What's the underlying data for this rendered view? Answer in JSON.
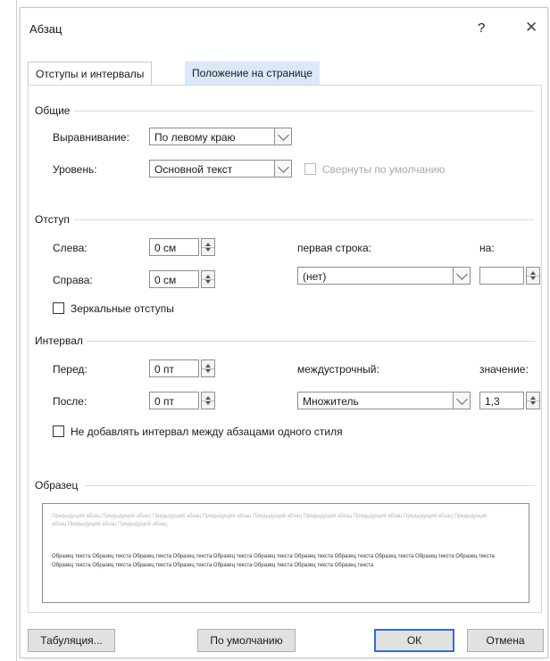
{
  "dialog": {
    "title": "Абзац",
    "help": "?",
    "close": "✕"
  },
  "tabs": [
    "Отступы и интервалы",
    "Положение на странице"
  ],
  "general": {
    "section": "Общие",
    "alignment_label": "Выравнивание:",
    "alignment_value": "По левому краю",
    "level_label": "Уровень:",
    "level_value": "Основной текст",
    "collapsed_label": "Свернуты по умолчанию"
  },
  "indent": {
    "section": "Отступ",
    "left_label": "Слева:",
    "left_value": "0 см",
    "right_label": "Справа:",
    "right_value": "0 см",
    "first_line_label": "первая строка:",
    "first_line_value": "(нет)",
    "by_label": "на:",
    "by_value": "",
    "mirror_label": "Зеркальные отступы"
  },
  "spacing": {
    "section": "Интервал",
    "before_label": "Перед:",
    "before_value": "0 пт",
    "after_label": "После:",
    "after_value": "0 пт",
    "line_spacing_label": "междустрочный:",
    "line_spacing_value": "Множитель",
    "at_label": "значение:",
    "at_value": "1,3",
    "dont_add_label": "Не добавлять интервал между абзацами одного стиля"
  },
  "preview": {
    "section": "Образец",
    "previous_text": "Предыдущий абзац Предыдущий абзац Предыдущий абзац Предыдущий абзац Предыдущий абзац Предыдущий абзац Предыдущий абзац Предыдущий абзац Предыдущий абзац Предыдущий абзац Предыдущий абзац",
    "sample_text": "Образец текста Образец текста Образец текста Образец текста Образец текста Образец текста Образец текста Образец текста Образец текста Образец текста Образец текста Образец текста Образец текста Образец текста Образец текста Образец текста Образец текста Образец текста Образец текста"
  },
  "buttons": {
    "tabs": "Табуляция...",
    "default": "По умолчанию",
    "ok": "ОК",
    "cancel": "Отмена"
  },
  "colors": {
    "accent": "#2a6fd6",
    "tab_inactive": "#dae8f7",
    "disabled": "#a9a9a9"
  }
}
